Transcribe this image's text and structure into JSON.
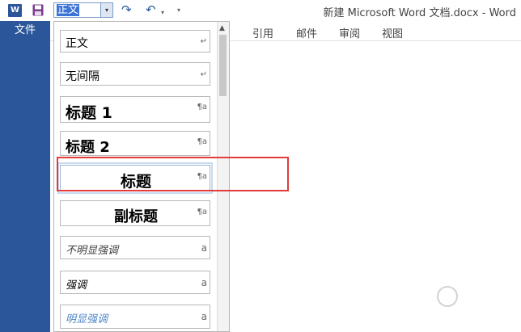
{
  "window": {
    "title": "新建 Microsoft Word 文档.docx - Word",
    "app_logo_text": "W"
  },
  "quick_access": {
    "style_value": "正文",
    "dropdown_arrow": "▾",
    "redo_icon": "↷",
    "undo_icon": "↶",
    "undo_dropdown": "▾",
    "customize_icon": "▾"
  },
  "ribbon": {
    "file_tab": "文件",
    "tabs": [
      "引用",
      "邮件",
      "审阅",
      "视图"
    ]
  },
  "styles_gallery": {
    "items": [
      {
        "label": "正文",
        "mark": "↵"
      },
      {
        "label": "无间隔",
        "mark": "↵"
      },
      {
        "label": "标题 1",
        "mark": "¶a"
      },
      {
        "label": "标题 2",
        "mark": "¶a"
      },
      {
        "label": "标题",
        "mark": "¶a"
      },
      {
        "label": "副标题",
        "mark": "¶a"
      },
      {
        "label": "不明显强调",
        "mark": "a"
      },
      {
        "label": "强调",
        "mark": "a"
      },
      {
        "label": "明显强调",
        "mark": "a"
      }
    ],
    "selected_index": 4,
    "scroll_up_icon": "▲"
  },
  "colors": {
    "word_blue": "#2b579a",
    "highlight_red": "#e13b3b",
    "selection_blue": "#3b74d6",
    "intense_emphasis": "#4f86c6"
  }
}
